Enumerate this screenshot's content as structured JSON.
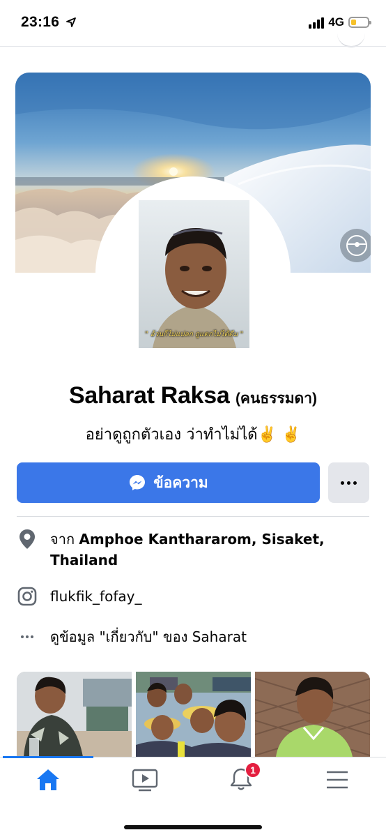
{
  "status_bar": {
    "time": "23:16",
    "network": "4G",
    "battery_level": 0.3,
    "location_icon": "location-arrow-icon"
  },
  "profile": {
    "name": "Saharat Raksa",
    "alt_name": "(คนธรรมดา)",
    "bio": "อย่าดูถูกตัวเอง ว่าทำไม่ได้✌️ ✌️",
    "picture_caption": "\" อ้วนก็ไม่แปลก ถูแตกไม่ได้ดีม \""
  },
  "actions": {
    "message_label": "ข้อความ",
    "message_icon": "messenger-icon",
    "more_icon": "more-dots-icon"
  },
  "info": {
    "location_prefix": "จาก",
    "location_value": "Amphoe Kanthararom, Sisaket, Thailand",
    "instagram": "flukfik_fofay_",
    "about_link": "ดูข้อมูล \"เกี่ยวกับ\" ของ Saharat"
  },
  "tabbar": {
    "items": [
      {
        "name": "home",
        "icon": "home-icon",
        "active": true
      },
      {
        "name": "watch",
        "icon": "video-play-icon",
        "active": false
      },
      {
        "name": "notifications",
        "icon": "bell-icon",
        "active": false
      },
      {
        "name": "menu",
        "icon": "hamburger-menu-icon",
        "active": false
      }
    ],
    "notification_count": "1"
  },
  "colors": {
    "accent": "#3b77e8",
    "facebook_blue": "#1877f2",
    "badge_red": "#e41e3f"
  }
}
